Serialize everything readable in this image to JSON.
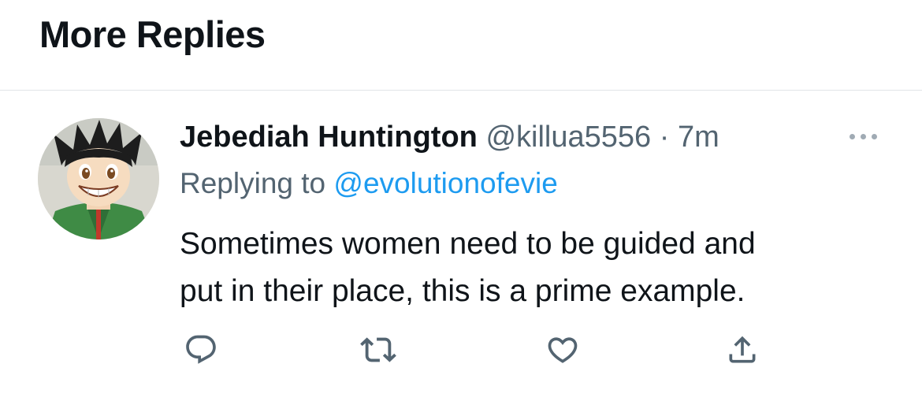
{
  "section": {
    "title": "More Replies"
  },
  "tweet": {
    "display_name": "Jebediah Huntington",
    "handle": "@killua5556",
    "separator": "·",
    "time": "7m",
    "replying_prefix": "Replying to",
    "replying_to": "@evolutionofevie",
    "text_line1": "Sometimes women need to be guided and",
    "text_line2": "put in their place, this is a prime example.",
    "more_icon": "more-horizontal-icon"
  },
  "actions": [
    {
      "name": "reply",
      "icon": "comment-icon"
    },
    {
      "name": "retweet",
      "icon": "retweet-icon"
    },
    {
      "name": "like",
      "icon": "heart-icon"
    },
    {
      "name": "share",
      "icon": "share-icon"
    }
  ],
  "colors": {
    "text": "#0f1419",
    "secondary": "#536471",
    "link": "#1d9bf0",
    "divider": "#e1e4e7"
  }
}
